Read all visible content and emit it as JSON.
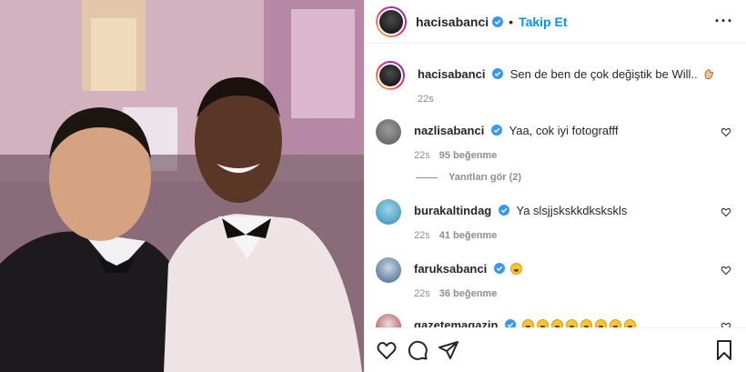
{
  "colors": {
    "accent": "#0095f6",
    "muted": "#8e8e8e",
    "text": "#262626"
  },
  "post": {
    "username": "hacisabanci",
    "separator": "•",
    "follow_label": "Takip Et",
    "more_icon": "more-horizontal-icon"
  },
  "caption": {
    "username": "hacisabanci",
    "text": "Sen de ben de çok değiştik be Will..",
    "time": "22s"
  },
  "comments": [
    {
      "username": "nazlisabanci",
      "text": "Yaa, cok iyi fotografff",
      "time": "22s",
      "likes": "95 beğenme",
      "replies": "Yanıtları gör (2)"
    },
    {
      "username": "burakaltindag",
      "text": "Ya slsjjskskkdkskskls",
      "time": "22s",
      "likes": "41 beğenme"
    },
    {
      "username": "faruksabanci",
      "text": "",
      "emoji_count": 1,
      "time": "22s",
      "likes": "36 beğenme"
    },
    {
      "username": "gazetemagazin",
      "text": "",
      "emoji_count": 8
    }
  ],
  "actions": [
    "heart-icon",
    "comment-icon",
    "share-icon",
    "bookmark-icon"
  ]
}
